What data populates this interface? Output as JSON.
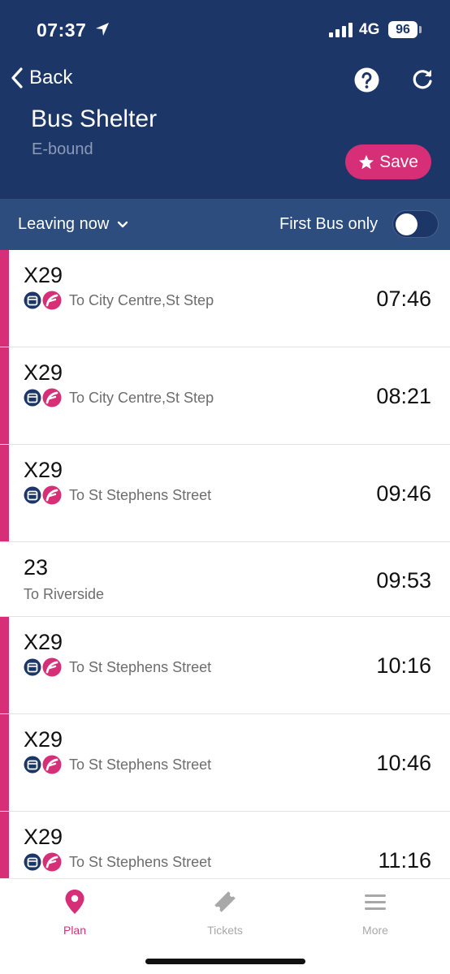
{
  "status_bar": {
    "time": "07:37",
    "network": "4G",
    "battery": "96"
  },
  "nav": {
    "back_label": "Back"
  },
  "stop": {
    "name": "Bus Shelter",
    "direction": "E-bound",
    "save_label": "Save"
  },
  "filters": {
    "leaving_label": "Leaving now",
    "first_bus_label": "First Bus only",
    "first_bus_only": false
  },
  "departures": [
    {
      "route": "X29",
      "destination": "To City Centre,St Step",
      "time": "07:46"
    },
    {
      "route": "X29",
      "destination": "To City Centre,St Step",
      "time": "08:21"
    },
    {
      "route": "X29",
      "destination": "To St Stephens Street",
      "time": "09:46"
    },
    {
      "route": "23",
      "destination": "To Riverside",
      "time": "09:53"
    },
    {
      "route": "X29",
      "destination": "To St Stephens Street",
      "time": "10:16"
    },
    {
      "route": "X29",
      "destination": "To St Stephens Street",
      "time": "10:46"
    },
    {
      "route": "X29",
      "destination": "To St Stephens Street",
      "time": "11:16"
    }
  ],
  "tabs": {
    "plan": "Plan",
    "tickets": "Tickets",
    "more": "More"
  },
  "colors": {
    "header": "#1c3767",
    "filter_bar": "#2c4d7e",
    "accent": "#d72f77",
    "inactive_tab": "#a8a8a8"
  }
}
